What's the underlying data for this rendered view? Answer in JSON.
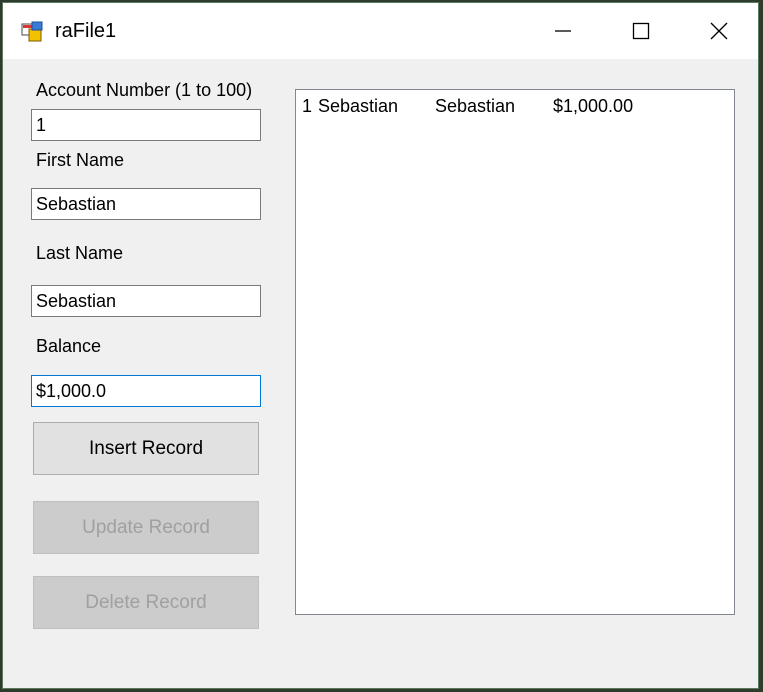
{
  "window": {
    "title": "raFile1",
    "icon": "winforms-app-icon"
  },
  "titlebar_buttons": {
    "minimize": "minimize-icon",
    "maximize": "maximize-icon",
    "close": "close-icon"
  },
  "form": {
    "account_label": "Account Number (1 to 100)",
    "account_value": "1",
    "first_name_label": "First Name",
    "first_name_value": "Sebastian",
    "last_name_label": "Last Name",
    "last_name_value": "Sebastian",
    "balance_label": "Balance",
    "balance_value": "$1,000.0"
  },
  "buttons": {
    "insert": {
      "label": "Insert Record",
      "enabled": true
    },
    "update": {
      "label": "Update Record",
      "enabled": false
    },
    "delete": {
      "label": "Delete Record",
      "enabled": false
    }
  },
  "records": [
    {
      "account": "1",
      "first_name": "Sebastian",
      "last_name": "Sebastian",
      "balance": "$1,000.00"
    }
  ],
  "colors": {
    "focus_border": "#0078d7",
    "window_bg": "#f0f0f0"
  }
}
